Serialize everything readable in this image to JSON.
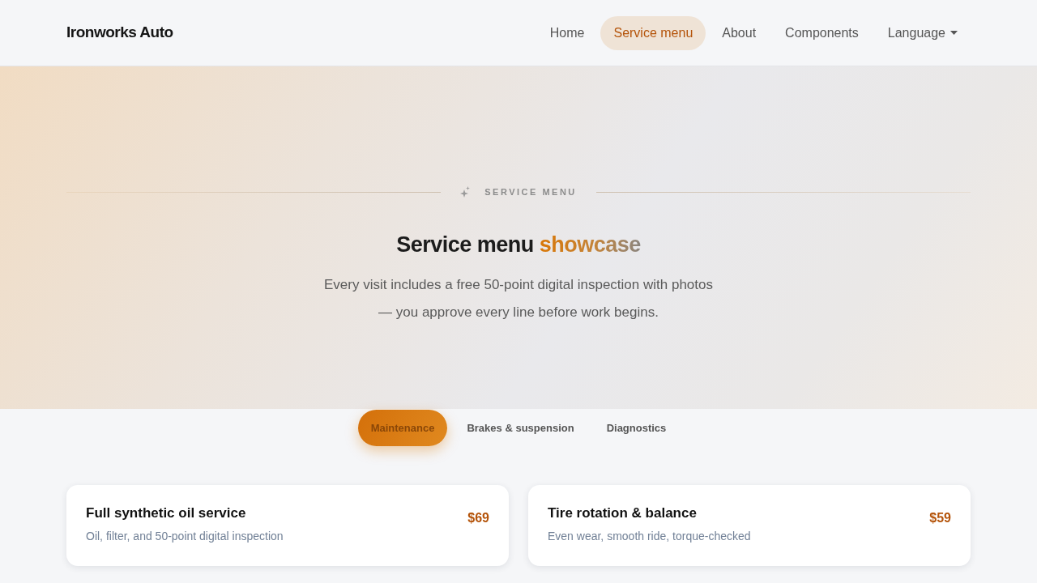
{
  "navbar": {
    "brand": "Ironworks Auto",
    "links": [
      {
        "label": "Home",
        "kind": "link",
        "selected": false
      },
      {
        "label": "Service menu",
        "kind": "link",
        "selected": true
      },
      {
        "label": "About",
        "kind": "link",
        "selected": false
      },
      {
        "label": "Components",
        "kind": "link",
        "selected": false
      },
      {
        "label": "Language",
        "kind": "dropdown",
        "selected": false
      }
    ]
  },
  "hero": {
    "eyebrow": "SERVICE MENU",
    "title": "Service menu",
    "title_accent": "showcase",
    "lead": "Every visit includes a free 50-point digital inspection with photos — you approve every line before work begins."
  },
  "tabs": [
    {
      "label": "Maintenance",
      "selected": true
    },
    {
      "label": "Brakes & suspension",
      "selected": false
    },
    {
      "label": "Diagnostics",
      "selected": false
    }
  ],
  "services": [
    {
      "name": "Full synthetic oil service",
      "description": "Oil, filter, and 50-point digital inspection",
      "price": "$69"
    },
    {
      "name": "Tire rotation & balance",
      "description": "Even wear, smooth ride, torque-checked",
      "price": "$59"
    }
  ]
}
